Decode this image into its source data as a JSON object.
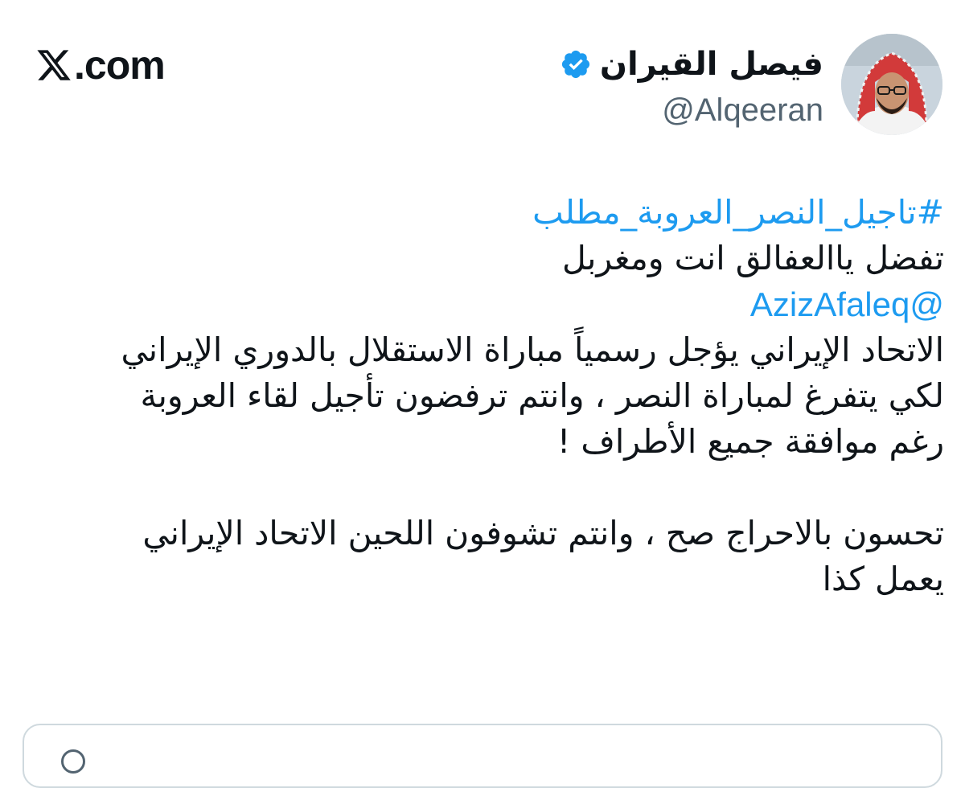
{
  "brand": {
    "label": ".com",
    "icon": "x-logo-icon"
  },
  "author": {
    "name": "فيصل القيران",
    "handle": "@Alqeeran",
    "verified": true,
    "verified_color": "#1d9bf0"
  },
  "tweet": {
    "hashtag": "#تاجيل_النصر_العروبة_مطلب",
    "line1": "تفضل ياالعفالق انت ومغربل",
    "mention": "@AzizAfaleq",
    "para1": [
      "الاتحاد الإيراني يؤجل رسمياً مباراة الاستقلال بالدوري الإيراني",
      "لكي يتفرغ لمباراة النصر ، وانتم ترفضون تأجيل لقاء العروبة",
      "رغم موافقة جميع الأطراف !"
    ],
    "para2": [
      "تحسون بالاحراج صح ، وانتم تشوفون اللحين الاتحاد الإيراني",
      "يعمل كذا"
    ]
  },
  "colors": {
    "link": "#1d9bf0",
    "text": "#0f1419",
    "secondary": "#536471",
    "border": "#cfd9de"
  }
}
